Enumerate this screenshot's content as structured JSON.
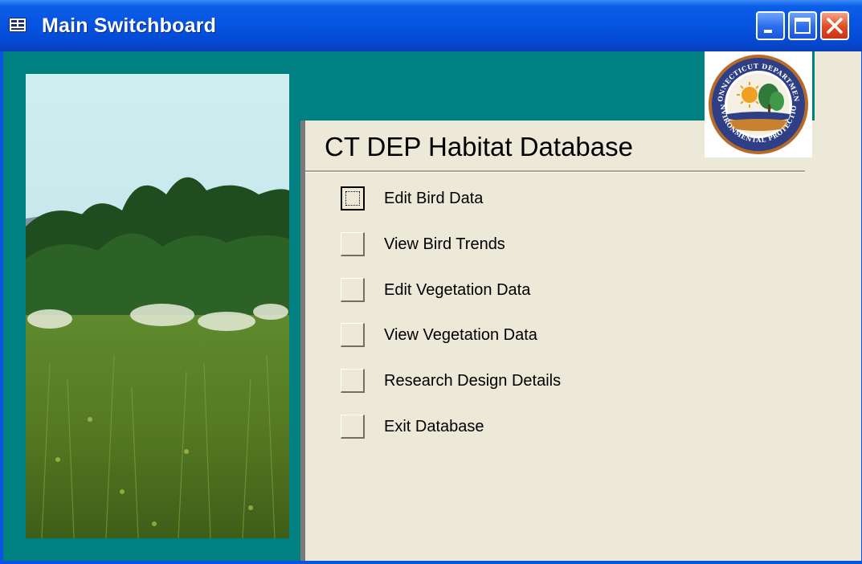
{
  "window": {
    "title": "Main Switchboard",
    "icon": "access-form-icon",
    "controls": [
      "minimize-icon",
      "maximize-icon",
      "close-icon"
    ]
  },
  "header": {
    "title": "CT DEP Habitat Database",
    "logo_icon": "ct-dep-seal-logo",
    "logo_text": "CONNECTICUT DEPARTMENT · ENVIRONMENTAL PROTECTION"
  },
  "photo": {
    "icon": "meadow-habitat-photo"
  },
  "menu": {
    "items": [
      {
        "label": "Edit Bird Data",
        "focused": true
      },
      {
        "label": "View Bird Trends"
      },
      {
        "label": "Edit Vegetation Data"
      },
      {
        "label": "View Vegetation Data"
      },
      {
        "label": "Research Design Details"
      },
      {
        "label": "Exit Database"
      }
    ]
  },
  "colors": {
    "titlebar": "#0553e0",
    "client_background": "#008080",
    "panel_background": "#ece9d8",
    "close_button": "#e04a1e"
  }
}
